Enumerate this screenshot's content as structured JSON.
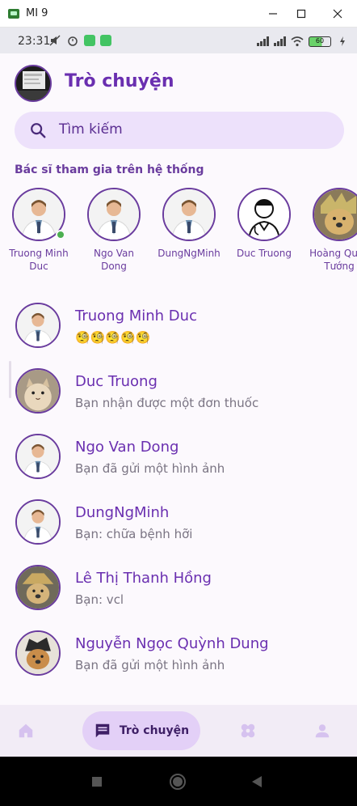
{
  "window": {
    "title": "MI 9"
  },
  "status_bar": {
    "time": "23:31",
    "battery": "60"
  },
  "header": {
    "title": "Trò chuyện"
  },
  "search": {
    "placeholder": "Tìm kiếm"
  },
  "section_title": "Bác sĩ tham gia trên hệ thống",
  "doctors": [
    {
      "name": "Truong Minh Duc",
      "online": true,
      "avatar": "doctor-photo"
    },
    {
      "name": "Ngo Van Dong",
      "online": false,
      "avatar": "doctor-photo"
    },
    {
      "name": "DungNgMinh",
      "online": false,
      "avatar": "doctor-photo"
    },
    {
      "name": "Duc Truong",
      "online": false,
      "avatar": "doctor-cartoon"
    },
    {
      "name": "Hoàng Quốc Tướng",
      "online": false,
      "avatar": "dog-photo"
    }
  ],
  "chats": [
    {
      "name": "Truong Minh Duc",
      "message": "🧐🧐🧐🧐🧐",
      "avatar": "doctor-photo"
    },
    {
      "name": "Duc Truong",
      "message": "Bạn nhận được một đơn thuốc",
      "avatar": "cat-photo"
    },
    {
      "name": "Ngo Van Dong",
      "message": "Bạn đã gửi một hình ảnh",
      "avatar": "doctor-photo"
    },
    {
      "name": "DungNgMinh",
      "message": "Bạn: chữa bệnh hỡi",
      "avatar": "doctor-photo"
    },
    {
      "name": "Lê Thị Thanh Hồng",
      "message": "Bạn: vcl",
      "avatar": "dog-photo"
    },
    {
      "name": "Nguyễn Ngọc Quỳnh Dung",
      "message": "Bạn đã gửi một hình ảnh",
      "avatar": "dog-photo-2"
    }
  ],
  "bottom_nav": {
    "items": [
      {
        "icon": "home-icon",
        "label": ""
      },
      {
        "icon": "chat-icon",
        "label": "Trò chuyện",
        "active": true
      },
      {
        "icon": "bandage-icon",
        "label": ""
      },
      {
        "icon": "person-icon",
        "label": ""
      }
    ]
  },
  "colors": {
    "primary": "#6a2fb0",
    "accent_bg": "#ede1fb",
    "nav_active": "#e3d0f7",
    "online": "#4caf50"
  }
}
